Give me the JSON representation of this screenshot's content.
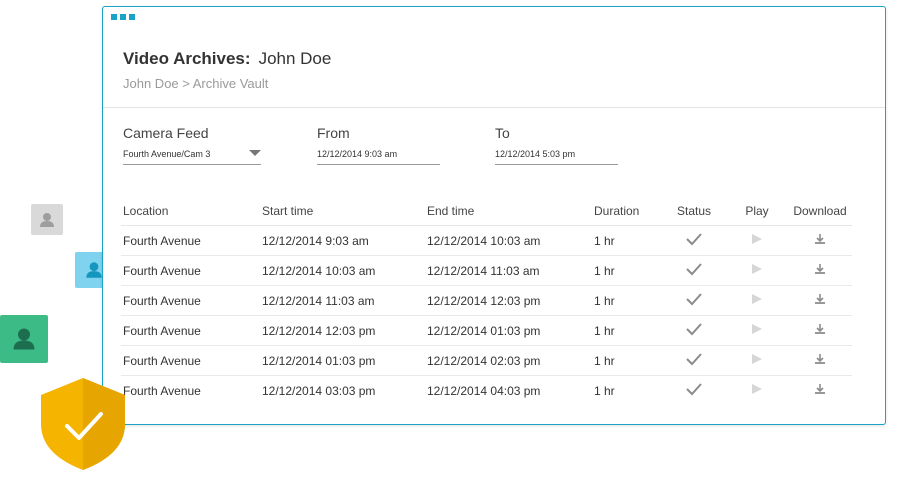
{
  "header": {
    "title_label": "Video Archives:",
    "title_name": "John Doe",
    "breadcrumb": "John Doe > Archive Vault"
  },
  "filters": {
    "camera_feed": {
      "label": "Camera Feed",
      "value": "Fourth Avenue/Cam 3"
    },
    "from": {
      "label": "From",
      "value": "12/12/2014 9:03 am"
    },
    "to": {
      "label": "To",
      "value": "12/12/2014 5:03 pm"
    }
  },
  "table": {
    "columns": [
      "Location",
      "Start time",
      "End time",
      "Duration",
      "Status",
      "Play",
      "Download"
    ],
    "rows": [
      {
        "location": "Fourth Avenue",
        "start": "12/12/2014 9:03 am",
        "end": "12/12/2014 10:03 am",
        "duration": "1 hr"
      },
      {
        "location": "Fourth Avenue",
        "start": "12/12/2014 10:03 am",
        "end": "12/12/2014 11:03 am",
        "duration": "1 hr"
      },
      {
        "location": "Fourth Avenue",
        "start": "12/12/2014 11:03 am",
        "end": "12/12/2014 12:03 pm",
        "duration": "1 hr"
      },
      {
        "location": "Fourth Avenue",
        "start": "12/12/2014 12:03 pm",
        "end": "12/12/2014 01:03 pm",
        "duration": "1 hr"
      },
      {
        "location": "Fourth Avenue",
        "start": "12/12/2014 01:03 pm",
        "end": "12/12/2014 02:03 pm",
        "duration": "1 hr"
      },
      {
        "location": "Fourth Avenue",
        "start": "12/12/2014 03:03 pm",
        "end": "12/12/2014 04:03 pm",
        "duration": "1 hr"
      }
    ]
  },
  "colors": {
    "accent": "#1aa3c8",
    "avatar_gray": "#d9d9d9",
    "avatar_blue": "#7fd3ef",
    "avatar_green": "#3dbb86",
    "shield": "#f4b400"
  },
  "icons": [
    "user-icon",
    "check-icon",
    "play-icon",
    "download-icon",
    "shield-check-icon",
    "caret-down-icon"
  ]
}
